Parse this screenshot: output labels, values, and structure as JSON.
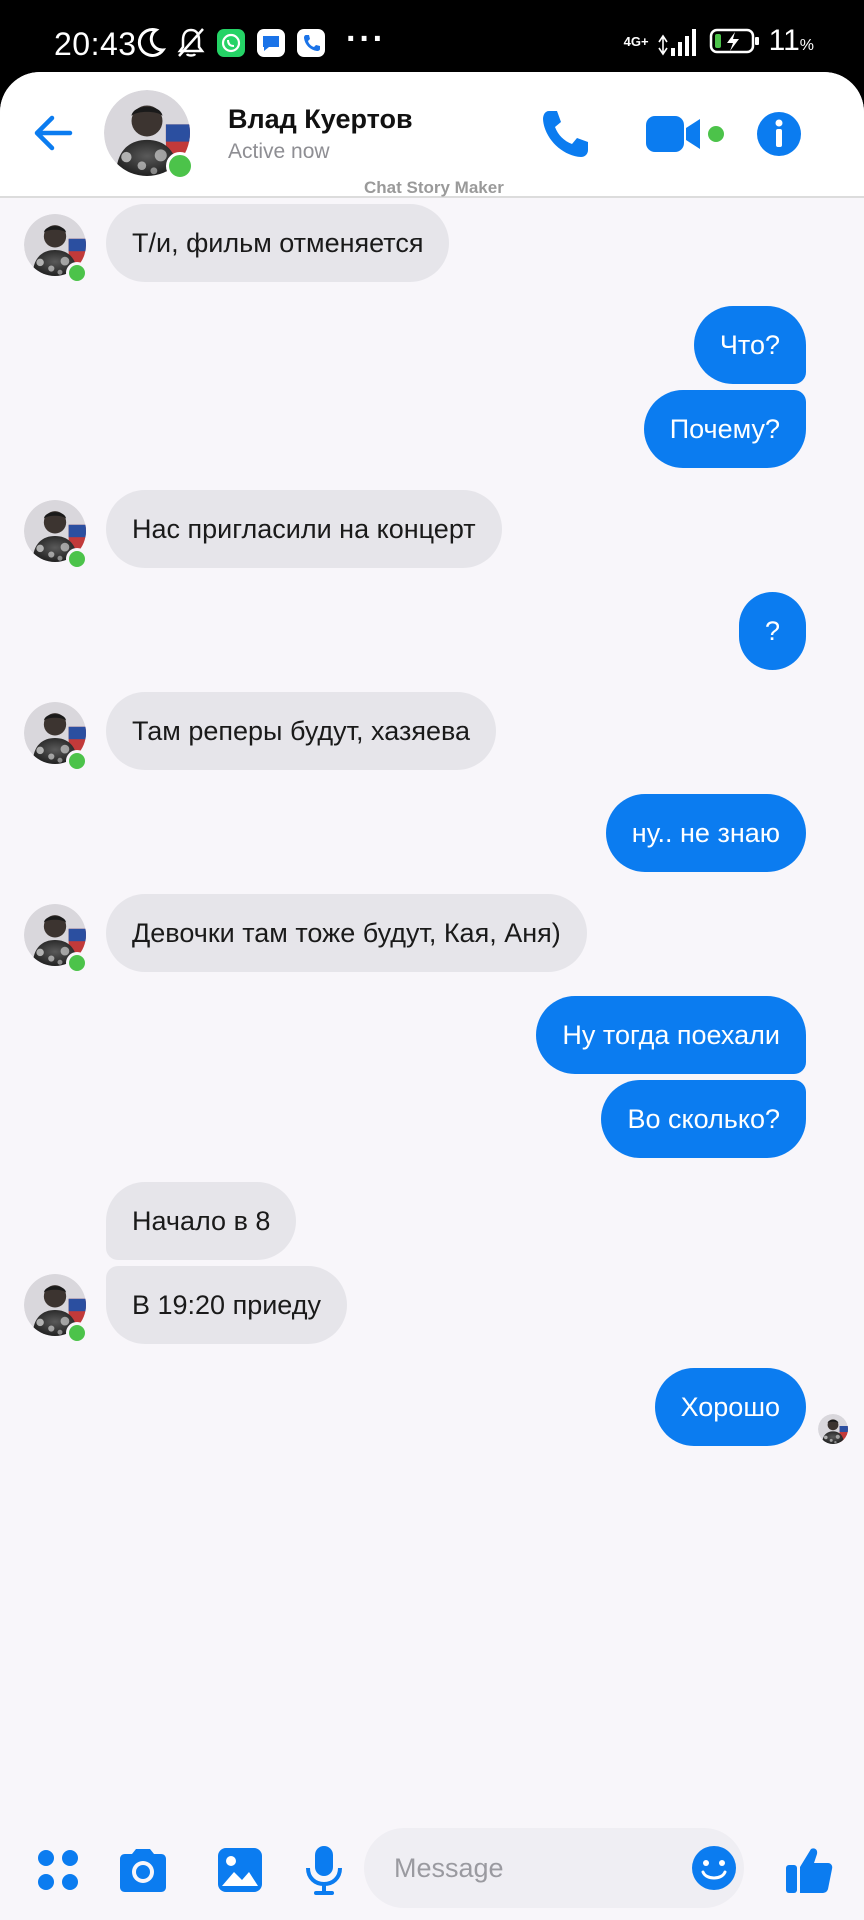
{
  "status_bar": {
    "time": "20:43",
    "network": "4G+",
    "battery": "11",
    "battery_unit": "%"
  },
  "header": {
    "contact_name": "Влад Куертов",
    "status": "Active now",
    "watermark": "Chat Story Maker"
  },
  "messages": [
    {
      "side": "in",
      "text": "Т/и, фильм отменяется"
    },
    {
      "side": "out",
      "text": "Что?"
    },
    {
      "side": "out",
      "text": "Почему?"
    },
    {
      "side": "in",
      "text": "Нас пригласили на концерт"
    },
    {
      "side": "out",
      "text": "?"
    },
    {
      "side": "in",
      "text": "Там реперы будут, хазяева"
    },
    {
      "side": "out",
      "text": "ну.. не знаю"
    },
    {
      "side": "in",
      "text": "Девочки там тоже будут, Кая, Аня)"
    },
    {
      "side": "out",
      "text": "Ну тогда поехали"
    },
    {
      "side": "out",
      "text": "Во сколько?"
    },
    {
      "side": "in",
      "text": "Начало в 8"
    },
    {
      "side": "in",
      "text": "В 19:20 приеду"
    },
    {
      "side": "out",
      "text": "Хорошо"
    }
  ],
  "composer": {
    "placeholder": "Message"
  },
  "colors": {
    "accent": "#0B7CF0",
    "online": "#4CC34A",
    "incoming_bubble": "#E6E5EA"
  }
}
